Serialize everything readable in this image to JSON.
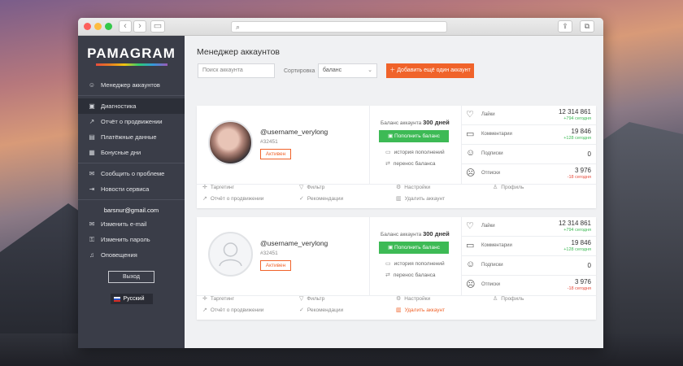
{
  "app": {
    "logo": "PAMAGRAM"
  },
  "sidebar": {
    "items": [
      {
        "label": "Менеджер аккаунтов",
        "icon": "users-icon"
      },
      {
        "label": "Диагностика",
        "icon": "diagnostics-icon"
      },
      {
        "label": "Отчёт о продвижении",
        "icon": "chart-icon"
      },
      {
        "label": "Платёжные данные",
        "icon": "card-icon"
      },
      {
        "label": "Бонусные дни",
        "icon": "calendar-icon"
      },
      {
        "label": "Сообщить о проблеме",
        "icon": "chat-icon"
      },
      {
        "label": "Новости сервиса",
        "icon": "exit-icon"
      }
    ],
    "email": "barsnur@gmail.com",
    "account_items": [
      {
        "label": "Изменить e-mail",
        "icon": "mail-icon"
      },
      {
        "label": "Изменить пароль",
        "icon": "key-icon"
      },
      {
        "label": "Оповещения",
        "icon": "bell-icon"
      }
    ],
    "logout": "Выход",
    "language": "Русский"
  },
  "main": {
    "title": "Менеджер аккаунтов",
    "search_placeholder": "Поиск аккаунта",
    "sort_label": "Сортировка",
    "sort_value": "баланс",
    "add_button": "Добавить ещё один аккаунт",
    "accounts": [
      {
        "username": "@username_verylong",
        "id": "#32451",
        "status": "Активен",
        "balance_label": "Баланс аккаунта",
        "balance_value": "300 дней",
        "topup": "Пополнить баланс",
        "history": "история пополнений",
        "transfer": "перенос баланса",
        "stats": [
          {
            "label": "Лайки",
            "value": "12 314 861",
            "delta": "+794 сегодня",
            "icon": "heart-icon"
          },
          {
            "label": "Комментарии",
            "value": "19 846",
            "delta": "+128 сегодня",
            "icon": "comment-icon"
          },
          {
            "label": "Подписки",
            "value": "0",
            "delta": "",
            "icon": "subscribe-icon"
          },
          {
            "label": "Отписки",
            "value": "3 976",
            "delta": "-18 сегодня",
            "icon": "unsubscribe-icon"
          }
        ],
        "actions": {
          "targeting": "Таргетинг",
          "filter": "Фильтр",
          "settings": "Настройки",
          "profile": "Профиль",
          "report": "Отчёт о продвижении",
          "recommendations": "Рекомендации",
          "delete": "Удалить аккаунт"
        }
      },
      {
        "username": "@username_verylong",
        "id": "#32451",
        "status": "Активен",
        "balance_label": "Баланс аккаунта",
        "balance_value": "300 дней",
        "topup": "Пополнить баланс",
        "history": "история пополнений",
        "transfer": "перенос баланса",
        "stats": [
          {
            "label": "Лайки",
            "value": "12 314 861",
            "delta": "+794 сегодня",
            "icon": "heart-icon"
          },
          {
            "label": "Комментарии",
            "value": "19 846",
            "delta": "+128 сегодня",
            "icon": "comment-icon"
          },
          {
            "label": "Подписки",
            "value": "0",
            "delta": "",
            "icon": "subscribe-icon"
          },
          {
            "label": "Отписки",
            "value": "3 976",
            "delta": "-18 сегодня",
            "icon": "unsubscribe-icon"
          }
        ],
        "actions": {
          "targeting": "Таргетинг",
          "filter": "Фильтр",
          "settings": "Настройки",
          "profile": "Профиль",
          "report": "Отчёт о продвижении",
          "recommendations": "Рекомендации",
          "delete": "Удалить аккаунт"
        }
      }
    ]
  },
  "colors": {
    "accent_orange": "#f0632a",
    "success_green": "#3dba55",
    "sidebar_bg": "#3a3d48"
  }
}
